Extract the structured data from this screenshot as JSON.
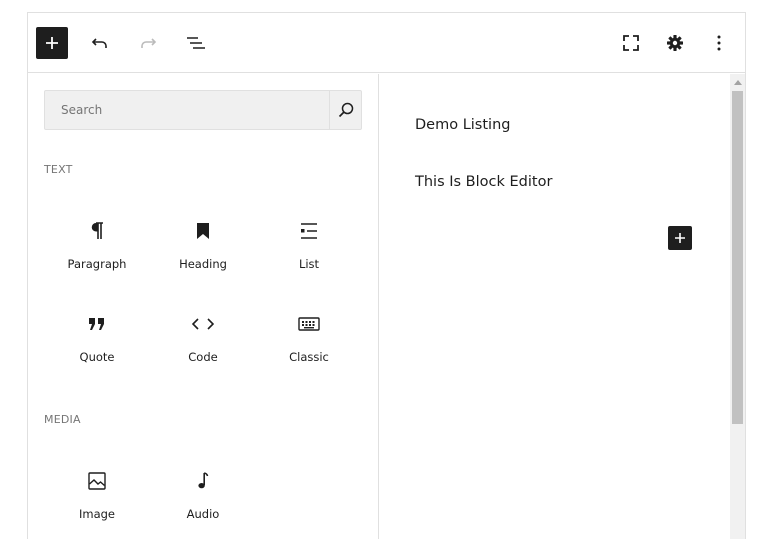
{
  "toolbar": {
    "inserter_icon": "plus-icon",
    "undo_icon": "undo-icon",
    "redo_icon": "redo-icon",
    "list_view_icon": "list-view-icon",
    "fullscreen_icon": "fullscreen-icon",
    "settings_icon": "gear-icon",
    "more_icon": "more-vertical-icon"
  },
  "inserter": {
    "search_placeholder": "Search",
    "search_value": "",
    "categories": [
      {
        "title": "TEXT",
        "blocks": [
          {
            "label": "Paragraph",
            "icon": "paragraph-icon"
          },
          {
            "label": "Heading",
            "icon": "heading-icon"
          },
          {
            "label": "List",
            "icon": "list-icon"
          },
          {
            "label": "Quote",
            "icon": "quote-icon"
          },
          {
            "label": "Code",
            "icon": "code-icon"
          },
          {
            "label": "Classic",
            "icon": "keyboard-icon"
          }
        ]
      },
      {
        "title": "MEDIA",
        "blocks": [
          {
            "label": "Image",
            "icon": "image-icon"
          },
          {
            "label": "Audio",
            "icon": "audio-icon"
          }
        ]
      }
    ]
  },
  "canvas": {
    "title": "Demo Listing",
    "paragraph": "This Is Block Editor"
  },
  "colors": {
    "primary_dark": "#1e1e1e",
    "border": "#e0e0e0",
    "muted_text": "#757575",
    "search_bg": "#f0f0f0"
  }
}
